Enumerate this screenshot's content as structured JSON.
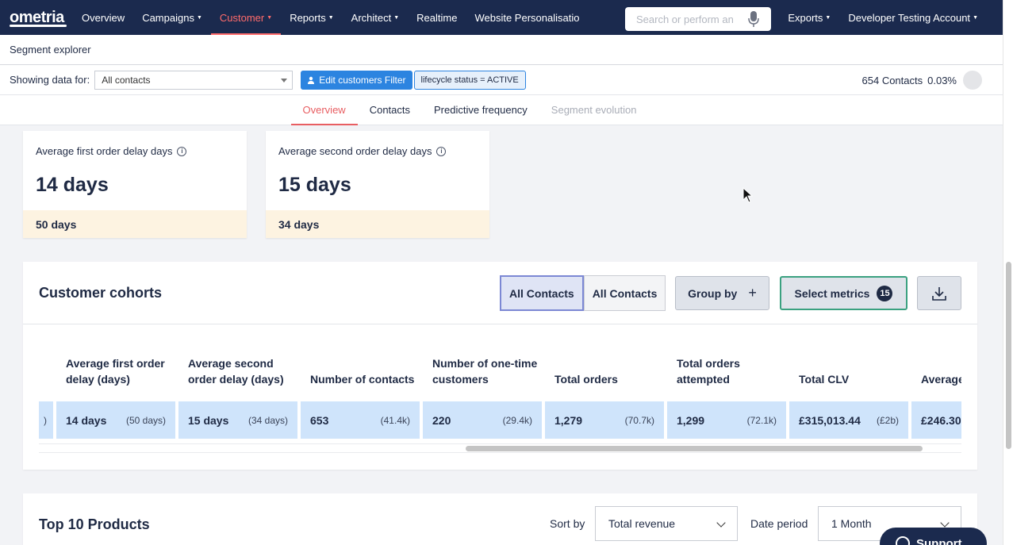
{
  "nav": {
    "logo": "ometria",
    "items": [
      "Overview",
      "Campaigns",
      "Customer",
      "Reports",
      "Architect",
      "Realtime",
      "Website Personalisatio"
    ],
    "caret_items": [
      false,
      true,
      true,
      true,
      true,
      false,
      false
    ],
    "search_placeholder": "Search or perform an",
    "right_items": [
      "Exports",
      "Developer Testing Account"
    ]
  },
  "subheader": {
    "title": "Segment explorer"
  },
  "filter": {
    "label": "Showing data for:",
    "selected": "All contacts",
    "edit_button": "Edit customers Filter",
    "tag": "lifecycle status = ACTIVE",
    "contacts": "654 Contacts",
    "percent": "0.03%"
  },
  "tabs": [
    "Overview",
    "Contacts",
    "Predictive frequency",
    "Segment evolution"
  ],
  "cards": [
    {
      "label": "Average first order delay days",
      "value": "14 days",
      "footer": "50 days"
    },
    {
      "label": "Average second order delay days",
      "value": "15 days",
      "footer": "34 days"
    }
  ],
  "cohorts": {
    "title": "Customer cohorts",
    "segments": [
      "All Contacts",
      "All Contacts"
    ],
    "group_by": "Group by",
    "select_metrics": "Select metrics",
    "metrics_count": "15",
    "partial_cell": ")",
    "columns": [
      {
        "header": "Average first order delay (days)",
        "value": "14 days",
        "sub": "(50 days)"
      },
      {
        "header": "Average second order delay (days)",
        "value": "15 days",
        "sub": "(34 days)"
      },
      {
        "header": "Number of contacts",
        "value": "653",
        "sub": "(41.4k)"
      },
      {
        "header": "Number of one-time customers",
        "value": "220",
        "sub": "(29.4k)"
      },
      {
        "header": "Total orders",
        "value": "1,279",
        "sub": "(70.7k)"
      },
      {
        "header": "Total orders attempted",
        "value": "1,299",
        "sub": "(72.1k)"
      },
      {
        "header": "Total CLV",
        "value": "£315,013.44",
        "sub": "(£2b)"
      },
      {
        "header": "Average value",
        "value": "£246.30",
        "sub": ""
      }
    ]
  },
  "products": {
    "title": "Top 10 Products",
    "sort_label": "Sort by",
    "sort_value": "Total revenue",
    "date_label": "Date period",
    "date_value": "1 Month"
  },
  "support": {
    "label": "Support"
  }
}
